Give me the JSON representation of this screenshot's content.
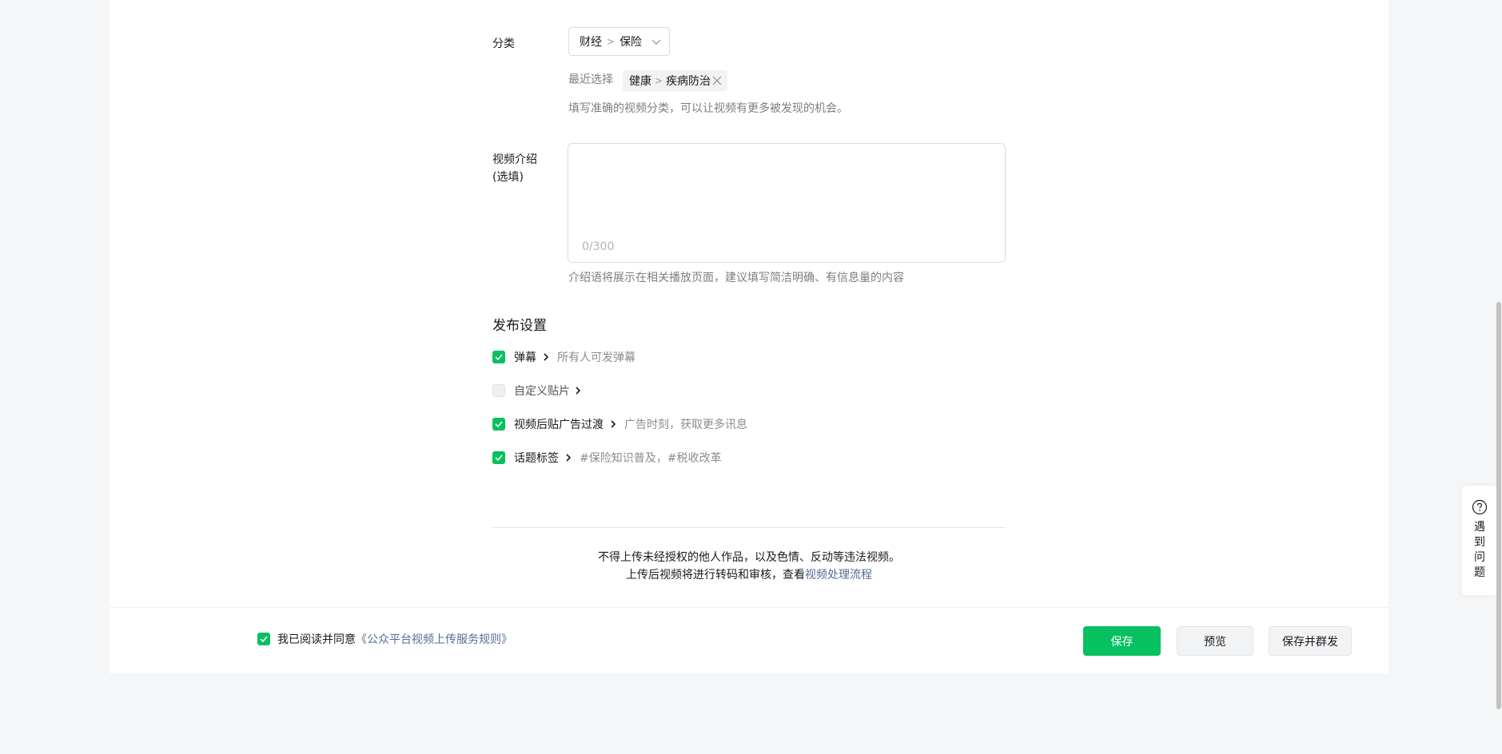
{
  "category": {
    "label": "分类",
    "selected_parent": "财经",
    "selected_child": "保险",
    "separator": ">",
    "recent_label": "最近选择",
    "recent_parent": "健康",
    "recent_child": "疾病防治",
    "hint": "填写准确的视频分类，可以让视频有更多被发现的机会。"
  },
  "intro": {
    "label_line1": "视频介绍",
    "label_line2": "(选填)",
    "counter": "0/300",
    "hint": "介绍语将展示在相关播放页面，建议填写简洁明确、有信息量的内容"
  },
  "publish": {
    "title": "发布设置",
    "options": [
      {
        "name": "弹幕",
        "desc": "所有人可发弹幕",
        "checked": true
      },
      {
        "name": "自定义贴片",
        "desc": "",
        "checked": false
      },
      {
        "name": "视频后贴广告过渡",
        "desc": "广告时刻，获取更多讯息",
        "checked": true
      },
      {
        "name": "话题标签",
        "desc": "#保险知识普及，#税收改革",
        "checked": true
      }
    ]
  },
  "notice": {
    "line1": "不得上传未经授权的他人作品，以及色情、反动等违法视频。",
    "line2_prefix": "上传后视频将进行转码和审核，查看",
    "line2_link": "视频处理流程"
  },
  "footer": {
    "agree_prefix": "我已阅读并同意",
    "agree_link": "《公众平台视频上传服务规则》",
    "save": "保存",
    "preview": "预览",
    "save_and_send": "保存并群发"
  },
  "help": {
    "text": "遇到问题"
  },
  "colors": {
    "accent": "#07c160",
    "link": "#576b95"
  }
}
